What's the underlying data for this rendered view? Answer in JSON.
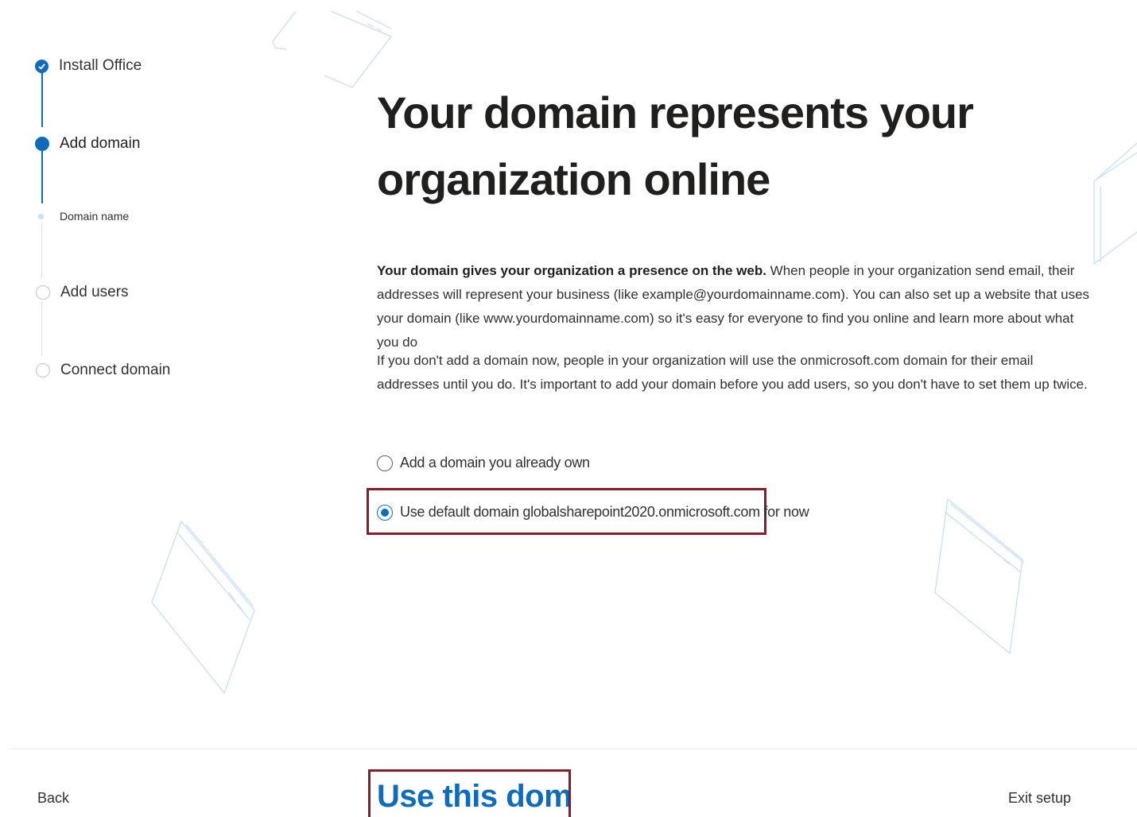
{
  "stepper": {
    "steps": [
      {
        "label": "Install Office",
        "state": "completed"
      },
      {
        "label": "Add domain",
        "state": "current"
      },
      {
        "label": "Domain name",
        "state": "current-substep"
      },
      {
        "label": "Add users",
        "state": "upcoming"
      },
      {
        "label": "Connect domain",
        "state": "upcoming"
      }
    ]
  },
  "main": {
    "title": "Your domain represents your organization online",
    "paragraph1_bold": "Your domain gives your organization a presence on the web.",
    "paragraph1_rest": " When people in your organization send email, their addresses will represent your business (like example@yourdomainname.com). You can also set up a website that uses your domain (like www.yourdomainname.com) so it's easy for everyone to find you online and learn more about what you do",
    "paragraph2": "If you don't add a domain now, people in your organization will use the onmicrosoft.com domain for their email addresses until you do. It's important to add your domain before you add users, so you don't have to set them up twice.",
    "options": [
      {
        "label": "Add a domain you already own",
        "selected": false
      },
      {
        "label": "Use default domain globalsharepoint2020.onmicrosoft.com for now",
        "selected": true
      }
    ]
  },
  "footer": {
    "back_label": "Back",
    "primary_label": "Use this domain",
    "exit_label": "Exit setup"
  },
  "colors": {
    "accent": "#0f6cbd",
    "highlight_border": "#8b1a2b",
    "decoration_stroke": "#c7e0f4"
  }
}
